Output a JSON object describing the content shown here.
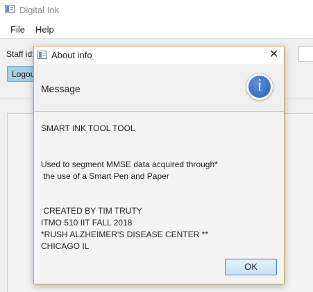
{
  "window": {
    "title": "Digital Ink",
    "icon": "app-window-icon"
  },
  "menu": {
    "items": [
      "File",
      "Help"
    ]
  },
  "main": {
    "staff_label": "Staff id:",
    "logout_label": "Logou"
  },
  "dialog": {
    "title": "About info",
    "close_glyph": "✕",
    "header": "Message",
    "info_glyph": "i",
    "lines": [
      "SMART INK TOOL TOOL",
      "Used to segment MMSE data acquired through*",
      " the use of a Smart Pen and Paper",
      " CREATED BY TIM TRUTY",
      "ITMO 510 IIT FALL 2018",
      "*RUSH ALZHEIMER'S DISEASE CENTER **",
      "CHICAGO IL"
    ],
    "ok_label": "OK"
  }
}
